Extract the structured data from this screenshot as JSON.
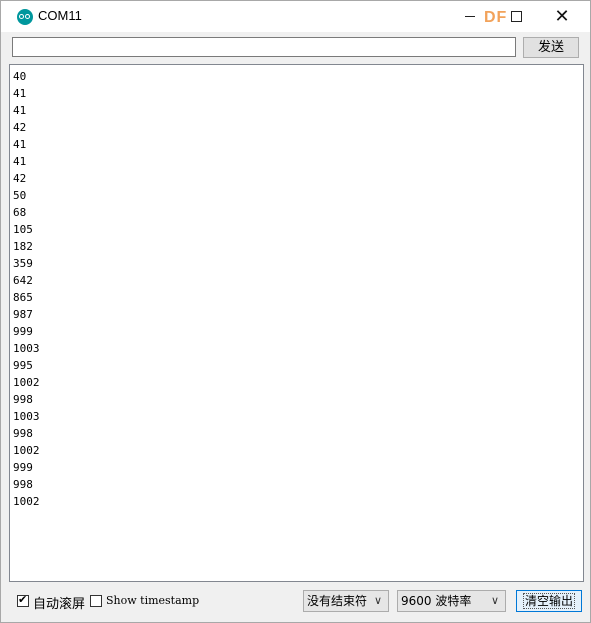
{
  "window": {
    "title": "COM11",
    "watermark": "DF",
    "close_glyph": "✕"
  },
  "input": {
    "value": "",
    "placeholder": "",
    "send_label": "发送"
  },
  "output": {
    "lines": [
      "40",
      "41",
      "41",
      "42",
      "41",
      "41",
      "42",
      "50",
      "68",
      "105",
      "182",
      "359",
      "642",
      "865",
      "987",
      "999",
      "1003",
      "995",
      "1002",
      "998",
      "1003",
      "998",
      "1002",
      "999",
      "998",
      "1002"
    ]
  },
  "footer": {
    "autoscroll_label": "自动滚屏",
    "autoscroll_checked": true,
    "timestamp_label": "Show timestamp",
    "timestamp_checked": false,
    "line_ending": "没有结束符",
    "baud_rate": "9600 波特率",
    "clear_label": "清空输出"
  },
  "colors": {
    "accent": "#00979d",
    "watermark": "#f2a25a"
  }
}
